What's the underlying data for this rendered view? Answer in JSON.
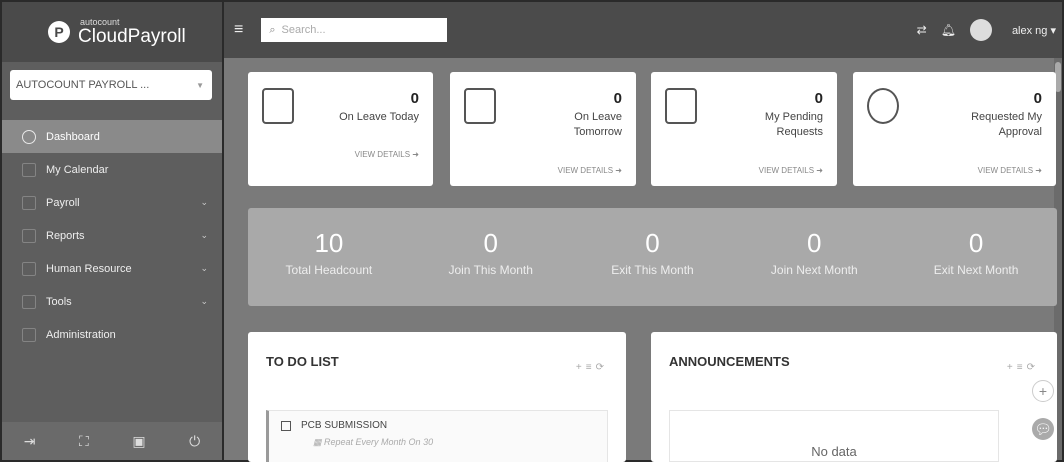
{
  "brand": {
    "small": "autocount",
    "big": "CloudPayroll",
    "mark": "P"
  },
  "company_select": {
    "value": "AUTOCOUNT PAYROLL ..."
  },
  "nav": [
    {
      "label": "Dashboard",
      "active": true,
      "chevron": false
    },
    {
      "label": "My Calendar",
      "active": false,
      "chevron": false
    },
    {
      "label": "Payroll",
      "active": false,
      "chevron": true
    },
    {
      "label": "Reports",
      "active": false,
      "chevron": true
    },
    {
      "label": "Human Resource",
      "active": false,
      "chevron": true
    },
    {
      "label": "Tools",
      "active": false,
      "chevron": true
    },
    {
      "label": "Administration",
      "active": false,
      "chevron": false
    }
  ],
  "search": {
    "placeholder": "Search..."
  },
  "user": {
    "name": "alex ng"
  },
  "stat_cards": [
    {
      "value": "0",
      "label": "On Leave Today",
      "link": "VIEW DETAILS"
    },
    {
      "value": "0",
      "label": "On Leave Tomorrow",
      "link": "VIEW DETAILS"
    },
    {
      "value": "0",
      "label": "My Pending Requests",
      "link": "VIEW DETAILS"
    },
    {
      "value": "0",
      "label": "Requested My Approval",
      "link": "VIEW DETAILS"
    }
  ],
  "summary": [
    {
      "value": "10",
      "label": "Total Headcount"
    },
    {
      "value": "0",
      "label": "Join This Month"
    },
    {
      "value": "0",
      "label": "Exit This Month"
    },
    {
      "value": "0",
      "label": "Join Next Month"
    },
    {
      "value": "0",
      "label": "Exit Next Month"
    }
  ],
  "todo": {
    "title": "TO DO LIST",
    "item_title": "PCB SUBMISSION",
    "item_sub": "Repeat Every Month On 30"
  },
  "announcements": {
    "title": "ANNOUNCEMENTS",
    "empty": "No data"
  }
}
